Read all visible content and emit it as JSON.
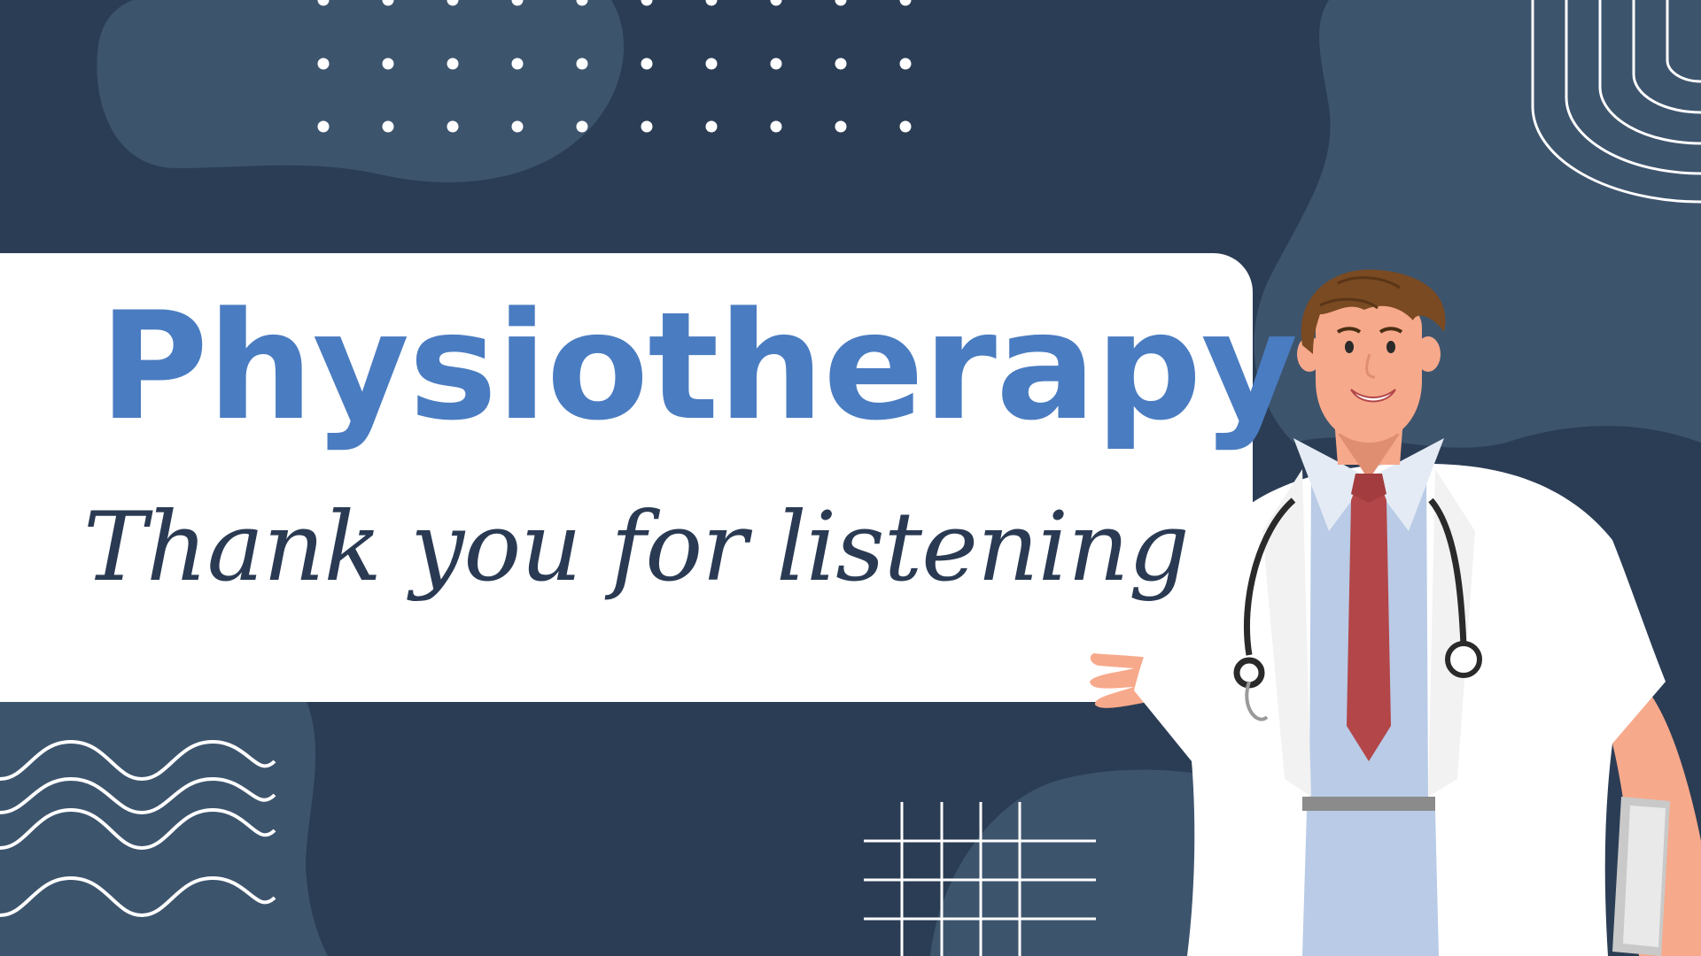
{
  "slide": {
    "title": "Physiotherapy",
    "subtitle": "Thank you for listening"
  },
  "colors": {
    "background": "#2b3d55",
    "blob": "#3d546d",
    "card": "#ffffff",
    "title": "#4a7cc1",
    "subtitle": "#2a3a53",
    "skin": "#f7a98b",
    "hair": "#7a4a22",
    "tie": "#b34648",
    "shirt": "#b9cbe6",
    "coat": "#ffffff"
  },
  "decorations": [
    "dot-grid",
    "wave-lines",
    "square-grid",
    "arch-lines",
    "blobs"
  ],
  "illustration": "doctor-with-stethoscope-presenting"
}
